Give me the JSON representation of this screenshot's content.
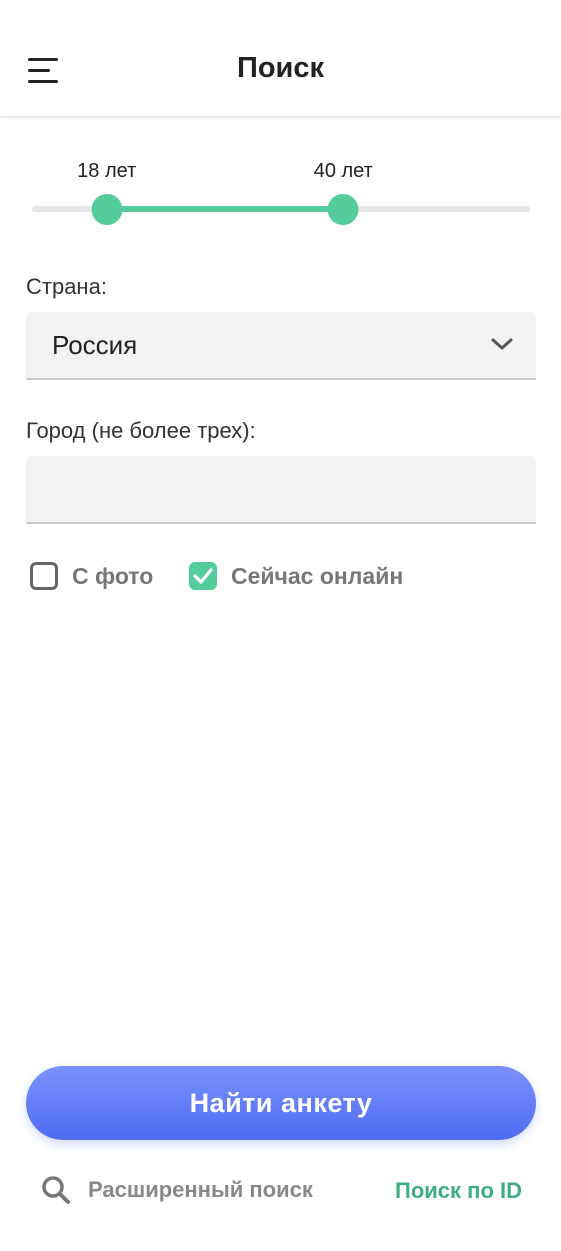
{
  "header": {
    "title": "Поиск",
    "menu_icon": "hamburger-menu-icon"
  },
  "age_range": {
    "min_label": "18 лет",
    "max_label": "40 лет",
    "min_value_fraction": 0.15,
    "max_value_fraction": 0.625,
    "accent_color": "#54cc9b"
  },
  "country": {
    "label": "Страна:",
    "value": "Россия",
    "icon": "chevron-down-icon"
  },
  "city": {
    "label": "Город (не более трех):",
    "value": ""
  },
  "filters": {
    "with_photo": {
      "label": "С фото",
      "checked": false
    },
    "online_now": {
      "label": "Сейчас онлайн",
      "checked": true
    }
  },
  "actions": {
    "find_label": "Найти анкету",
    "advanced_search_label": "Расширенный поиск",
    "advanced_search_icon": "search-icon",
    "id_search_label": "Поиск по ID"
  },
  "colors": {
    "accent_green": "#54cc9b",
    "button_blue": "#5b78f5",
    "link_green": "#3fae7f"
  }
}
